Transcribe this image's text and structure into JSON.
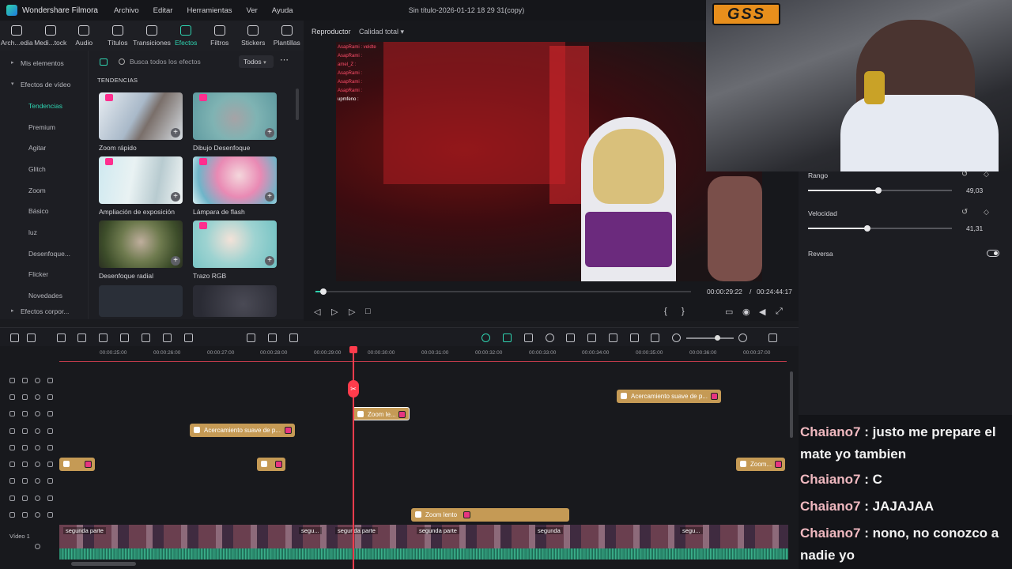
{
  "titlebar": {
    "app_name": "Wondershare Filmora",
    "menu": [
      "Archivo",
      "Editar",
      "Herramientas",
      "Ver",
      "Ayuda"
    ],
    "document": "Sin título-2026-01-12 18 29 31(copy)"
  },
  "tabs": [
    "Arch...edia",
    "Medi...tock",
    "Audio",
    "Títulos",
    "Transiciones",
    "Efectos",
    "Filtros",
    "Stickers",
    "Plantillas"
  ],
  "active_tab": "Efectos",
  "sidebar": {
    "top": [
      "Mis elementos",
      "Efectos de vídeo"
    ],
    "items": [
      "Tendencias",
      "Premium",
      "Agitar",
      "Glitch",
      "Zoom",
      "Básico",
      "luz",
      "Desenfoque...",
      "Flicker",
      "Novedades"
    ],
    "bottom": "Efectos corpor..."
  },
  "effects": {
    "search_placeholder": "Busca todos los efectos",
    "filter": "Todos",
    "section": "TENDENCIAS",
    "cards": [
      "Zoom rápido",
      "Dibujo Desenfoque",
      "Ampliación de exposición",
      "Lámpara de flash",
      "Desenfoque radial",
      "Trazo RGB"
    ]
  },
  "player": {
    "label": "Reproductor",
    "quality": "Calidad total",
    "current_time": "00:00:29:22",
    "separator": "/",
    "total_time": "00:24:44:17",
    "progress_fraction": 0.02
  },
  "overlay_chat": [
    "AsapRami : veldte",
    "AsapRami :",
    "amel_Z :",
    "AsapRami :",
    "AsapRami :",
    "AsapRami :",
    "upmfeno :"
  ],
  "ruler_ticks": [
    "00:00:25:00",
    "00:00:26:00",
    "00:00:27:00",
    "00:00:28:00",
    "00:00:29:00",
    "00:00:30:00",
    "00:00:31:00",
    "00:00:32:00",
    "00:00:33:00",
    "00:00:34:00",
    "00:00:35:00",
    "00:00:36:00",
    "00:00:37:00"
  ],
  "clips": {
    "a": "Acercamiento suave de p...",
    "b": "Zoom le...",
    "c": "Acercamiento suave de p...",
    "d": "Zoom...",
    "e": "Zoom lento"
  },
  "video_track": {
    "label": "Vídeo 1",
    "clips": [
      "segunda parte",
      "segu...",
      "segunda parte",
      "segunda parte",
      "segunda",
      "segu..."
    ]
  },
  "properties": {
    "rango_label": "Rango",
    "rango_value": "49,03",
    "rango_fraction": 0.49,
    "velocidad_label": "Velocidad",
    "velocidad_value": "41,31",
    "velocidad_fraction": 0.41,
    "reversa_label": "Reversa"
  },
  "webcam_logo": "GSS",
  "chat": [
    {
      "user": "Chaiano7",
      "text": ": justo me prepare el mate yo tambien"
    },
    {
      "user": "Chaiano7",
      "text": ": C"
    },
    {
      "user": "Chaiano7",
      "text": ": JAJAJAA"
    },
    {
      "user": "Chaiano7",
      "text": ": nono, no conozco a nadie yo"
    }
  ],
  "colors": {
    "accent": "#2fd3b0",
    "playhead": "#ff3c4c",
    "clip": "#c59a55"
  }
}
